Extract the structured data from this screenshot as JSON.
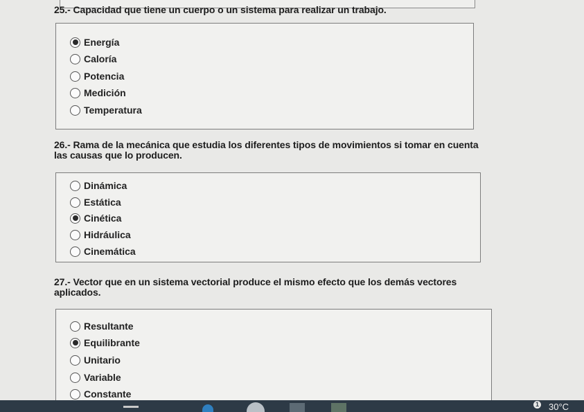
{
  "questions": [
    {
      "text": "25.- Capacidad que tiene un cuerpo o un sistema para realizar un trabajo.",
      "options": [
        {
          "label": "Energía",
          "selected": true
        },
        {
          "label": "Caloría",
          "selected": false
        },
        {
          "label": "Potencia",
          "selected": false
        },
        {
          "label": "Medición",
          "selected": false
        },
        {
          "label": "Temperatura",
          "selected": false
        }
      ]
    },
    {
      "text": "26.- Rama de la mecánica que estudia los diferentes tipos de movimientos si tomar en cuenta las causas que lo producen.",
      "options": [
        {
          "label": "Dinámica",
          "selected": false
        },
        {
          "label": "Estática",
          "selected": false
        },
        {
          "label": "Cinética",
          "selected": true
        },
        {
          "label": "Hidráulica",
          "selected": false
        },
        {
          "label": "Cinemática",
          "selected": false
        }
      ]
    },
    {
      "text": "27.- Vector que en un sistema vectorial produce el mismo efecto que los demás vectores aplicados.",
      "options": [
        {
          "label": "Resultante",
          "selected": false
        },
        {
          "label": "Equilibrante",
          "selected": true
        },
        {
          "label": "Unitario",
          "selected": false
        },
        {
          "label": "Variable",
          "selected": false
        },
        {
          "label": "Constante",
          "selected": false
        }
      ]
    }
  ],
  "taskbar": {
    "temperature": "30°C",
    "notification_badge": "1",
    "icons": [
      "file-explorer-icon",
      "edge-icon",
      "chrome-icon",
      "word-icon",
      "excel-icon"
    ]
  },
  "colors": {
    "taskbar": "#2d3a46",
    "background": "#e9e9e7",
    "box_border": "#7c7c7c"
  }
}
